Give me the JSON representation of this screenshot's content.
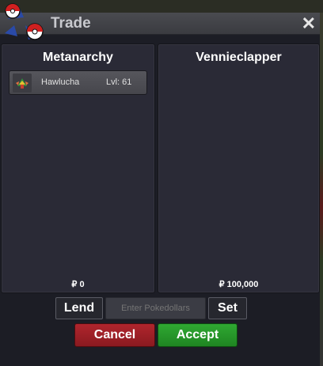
{
  "window": {
    "title": "Trade",
    "close_label": "✕"
  },
  "left_panel": {
    "player_name": "Metanarchy",
    "items": [
      {
        "name": "Hawlucha",
        "level": "Lvl: 61"
      }
    ],
    "money": "₽ 0"
  },
  "right_panel": {
    "player_name": "Vennieclapper",
    "items": [],
    "money": "₽ 100,000"
  },
  "controls": {
    "lend_label": "Lend",
    "pokedollars_placeholder": "Enter Pokedollars",
    "set_label": "Set",
    "cancel_label": "Cancel",
    "accept_label": "Accept"
  },
  "colors": {
    "cancel": "#b0252d",
    "accept": "#2fa832"
  }
}
